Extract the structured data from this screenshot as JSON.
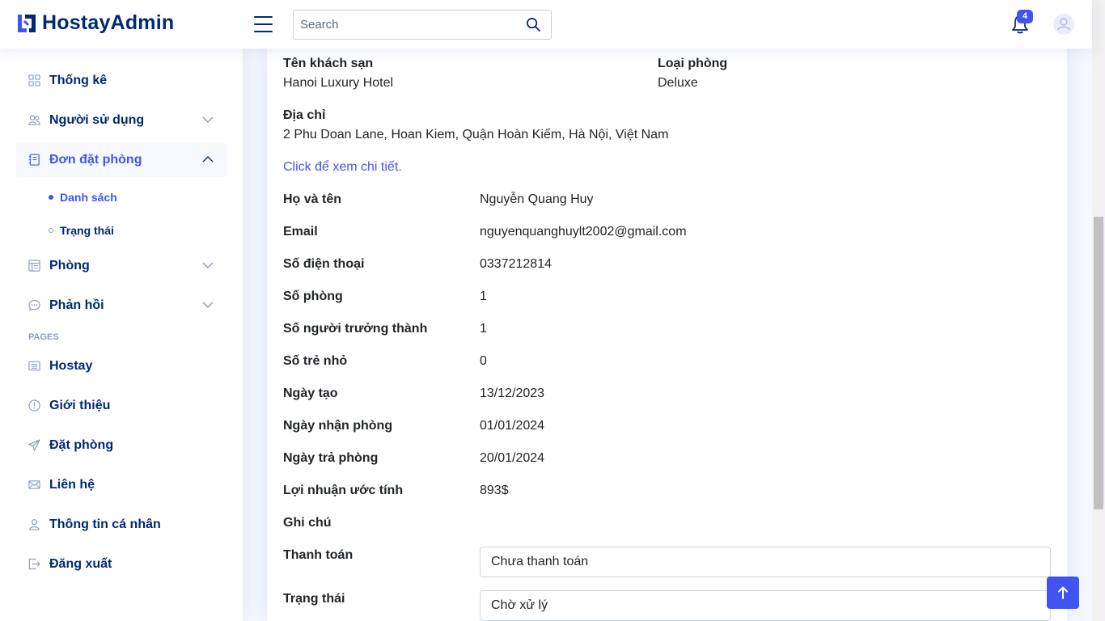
{
  "app": {
    "logo_text": "HostayAdmin"
  },
  "header": {
    "search_placeholder": "Search",
    "notification_count": "4"
  },
  "sidebar": {
    "items": [
      {
        "label": "Thống kê",
        "icon": "grid-icon"
      },
      {
        "label": "Người sử dụng",
        "icon": "people-icon"
      },
      {
        "label": "Đơn đặt phòng",
        "icon": "journal-icon"
      },
      {
        "label": "Phòng",
        "icon": "layout-icon"
      },
      {
        "label": "Phản hồi",
        "icon": "chat-icon"
      }
    ],
    "subitems": [
      {
        "label": "Danh sách"
      },
      {
        "label": "Trạng thái"
      }
    ],
    "pages_heading": "PAGES",
    "pages": [
      {
        "label": "Hostay",
        "icon": "card-list-icon"
      },
      {
        "label": "Giới thiệu",
        "icon": "info-icon"
      },
      {
        "label": "Đặt phòng",
        "icon": "send-icon"
      },
      {
        "label": "Liên hệ",
        "icon": "envelope-icon"
      },
      {
        "label": "Thông tin cá nhân",
        "icon": "person-icon"
      },
      {
        "label": "Đăng xuất",
        "icon": "logout-icon"
      }
    ]
  },
  "booking": {
    "hotel_label": "Tên khách sạn",
    "hotel_value": "Hanoi Luxury Hotel",
    "room_type_label": "Loại phòng",
    "room_type_value": "Deluxe",
    "address_label": "Địa chỉ",
    "address_value": "2 Phu Doan Lane, Hoan Kiem, Quận Hoàn Kiếm, Hà Nội, Việt Nam",
    "detail_link": "Click để xem chi tiết.",
    "rows": [
      {
        "label": "Họ và tên",
        "value": "Nguyễn Quang Huy"
      },
      {
        "label": "Email",
        "value": "nguyenquanghuylt2002@gmail.com"
      },
      {
        "label": "Số điện thoại",
        "value": "0337212814"
      },
      {
        "label": "Số phòng",
        "value": "1"
      },
      {
        "label": "Số người trưởng thành",
        "value": "1"
      },
      {
        "label": "Số trẻ nhỏ",
        "value": "0"
      },
      {
        "label": "Ngày tạo",
        "value": "13/12/2023"
      },
      {
        "label": "Ngày nhận phòng",
        "value": "01/01/2024"
      },
      {
        "label": "Ngày trả phòng",
        "value": "20/01/2024"
      },
      {
        "label": "Lợi nhuận ước tính",
        "value": "893$"
      },
      {
        "label": "Ghi chú",
        "value": ""
      }
    ],
    "payment_label": "Thanh toán",
    "payment_value": "Chưa thanh toán",
    "status_label": "Trạng thái",
    "status_value": "Chờ xử lý"
  },
  "colors": {
    "accent": "#4154f1",
    "navy": "#012970",
    "muted": "#899bbd"
  }
}
